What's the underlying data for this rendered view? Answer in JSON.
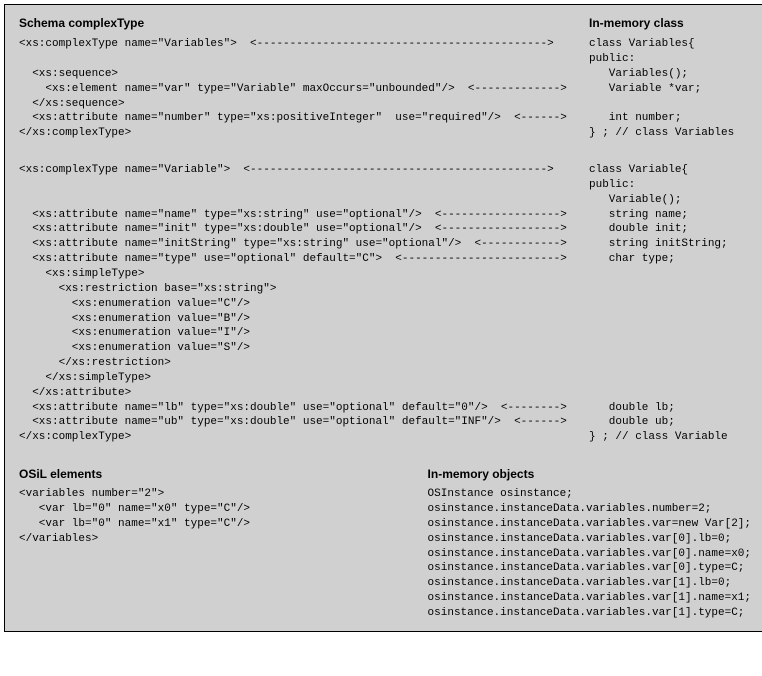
{
  "topHeaders": {
    "schema": "Schema complexType",
    "inmemClass": "In-memory class"
  },
  "block1": {
    "l1_left": "<xs:complexType name=\"Variables\">  <-------------------------------------------->",
    "l1_right": "class Variables{",
    "l2_left": "",
    "l2_right": "public:",
    "l3_left": "  <xs:sequence>",
    "l3_right": "   Variables();",
    "l4_left": "    <xs:element name=\"var\" type=\"Variable\" maxOccurs=\"unbounded\"/>  <------------->",
    "l4_right": "   Variable *var;",
    "l5_left": "  </xs:sequence>",
    "l5_right": "",
    "l6_left": "  <xs:attribute name=\"number\" type=\"xs:positiveInteger\"  use=\"required\"/>  <------>",
    "l6_right": "   int number;",
    "l7_left": "</xs:complexType>",
    "l7_right": "} ; // class Variables"
  },
  "block2": {
    "l1_left": "<xs:complexType name=\"Variable\">  <--------------------------------------------->",
    "l1_right": "class Variable{",
    "l2_left": "",
    "l2_right": "public:",
    "l3_left": "",
    "l3_right": "   Variable();",
    "l4_left": "  <xs:attribute name=\"name\" type=\"xs:string\" use=\"optional\"/>  <------------------>",
    "l4_right": "   string name;",
    "l5_left": "  <xs:attribute name=\"init\" type=\"xs:double\" use=\"optional\"/>  <------------------>",
    "l5_right": "   double init;",
    "l6_left": "  <xs:attribute name=\"initString\" type=\"xs:string\" use=\"optional\"/>  <------------>",
    "l6_right": "   string initString;",
    "l7_left": "  <xs:attribute name=\"type\" use=\"optional\" default=\"C\">  <------------------------>",
    "l7_right": "   char type;",
    "l8_left": "    <xs:simpleType>",
    "l9_left": "      <xs:restriction base=\"xs:string\">",
    "l10_left": "        <xs:enumeration value=\"C\"/>",
    "l11_left": "        <xs:enumeration value=\"B\"/>",
    "l12_left": "        <xs:enumeration value=\"I\"/>",
    "l13_left": "        <xs:enumeration value=\"S\"/>",
    "l14_left": "      </xs:restriction>",
    "l15_left": "    </xs:simpleType>",
    "l16_left": "  </xs:attribute>",
    "l17_left": "  <xs:attribute name=\"lb\" type=\"xs:double\" use=\"optional\" default=\"0\"/>  <-------->",
    "l17_right": "   double lb;",
    "l18_left": "  <xs:attribute name=\"ub\" type=\"xs:double\" use=\"optional\" default=\"INF\"/>  <------>",
    "l18_right": "   double ub;",
    "l19_left": "</xs:complexType>",
    "l19_right": "} ; // class Variable"
  },
  "bottomHeaders": {
    "osil": "OSiL elements",
    "inmemObj": "In-memory objects"
  },
  "osil": {
    "l1": "<variables number=\"2\">",
    "l2": "   <var lb=\"0\" name=\"x0\" type=\"C\"/>",
    "l3": "   <var lb=\"0\" name=\"x1\" type=\"C\"/>",
    "l4": "</variables>"
  },
  "objects": {
    "l1": "OSInstance osinstance;",
    "l2": "osinstance.instanceData.variables.number=2;",
    "l3": "osinstance.instanceData.variables.var=new Var[2];",
    "l4": "osinstance.instanceData.variables.var[0].lb=0;",
    "l5": "osinstance.instanceData.variables.var[0].name=x0;",
    "l6": "osinstance.instanceData.variables.var[0].type=C;",
    "l7": "osinstance.instanceData.variables.var[1].lb=0;",
    "l8": "osinstance.instanceData.variables.var[1].name=x1;",
    "l9": "osinstance.instanceData.variables.var[1].type=C;"
  }
}
